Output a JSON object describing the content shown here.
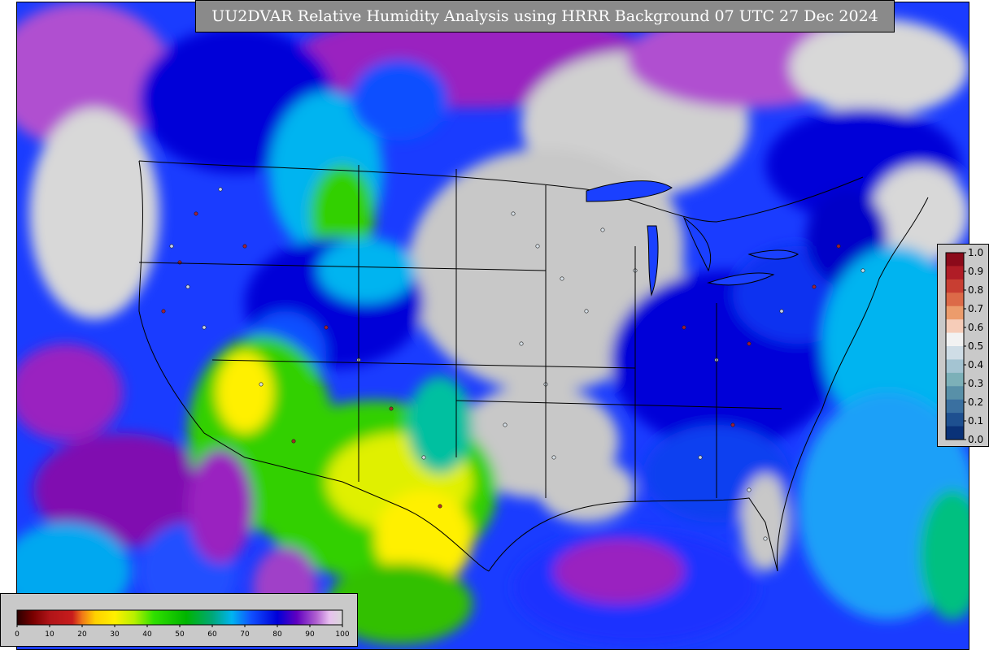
{
  "title": "UU2DVAR Relative Humidity Analysis using HRRR Background 07 UTC 27 Dec 2024",
  "field_legend": {
    "ticks": [
      "0",
      "10",
      "20",
      "30",
      "40",
      "50",
      "60",
      "70",
      "80",
      "90",
      "100"
    ],
    "stops": [
      {
        "v": 0,
        "c": "#2a0000"
      },
      {
        "v": 5,
        "c": "#7a0000"
      },
      {
        "v": 10,
        "c": "#b01418"
      },
      {
        "v": 17,
        "c": "#c81c1c"
      },
      {
        "v": 20,
        "c": "#f07818"
      },
      {
        "v": 24,
        "c": "#ffd000"
      },
      {
        "v": 30,
        "c": "#fff000"
      },
      {
        "v": 36,
        "c": "#b8f000"
      },
      {
        "v": 42,
        "c": "#30e000"
      },
      {
        "v": 52,
        "c": "#00b400"
      },
      {
        "v": 60,
        "c": "#00a878"
      },
      {
        "v": 66,
        "c": "#00b4f0"
      },
      {
        "v": 72,
        "c": "#1050ff"
      },
      {
        "v": 80,
        "c": "#0000d8"
      },
      {
        "v": 86,
        "c": "#6000c0"
      },
      {
        "v": 92,
        "c": "#b060d0"
      },
      {
        "v": 96,
        "c": "#e8c0f0"
      },
      {
        "v": 100,
        "c": "#d8d8d8"
      }
    ]
  },
  "obs_colorbar": {
    "ticks": [
      "1.0",
      "0.9",
      "0.8",
      "0.7",
      "0.6",
      "0.5",
      "0.4",
      "0.3",
      "0.2",
      "0.1",
      "0.0"
    ],
    "colors": [
      "#8b0a1a",
      "#b01c26",
      "#c83e32",
      "#dc6a48",
      "#ec9c6c",
      "#f6ccb8",
      "#f2f2f2",
      "#cfdde6",
      "#a4c4d2",
      "#7cb0b8",
      "#5890a8",
      "#3a70a0",
      "#1e5090",
      "#0a3278"
    ]
  },
  "colors": {
    "land_dry": "#c8c8c8",
    "ocean": "#00b4f0",
    "deep_blue": "#0000d8",
    "purple": "#8a10b0",
    "green": "#30d000",
    "yellow": "#fff000",
    "red_obs": "#b01c26",
    "light_obs": "#d8e2ea"
  }
}
